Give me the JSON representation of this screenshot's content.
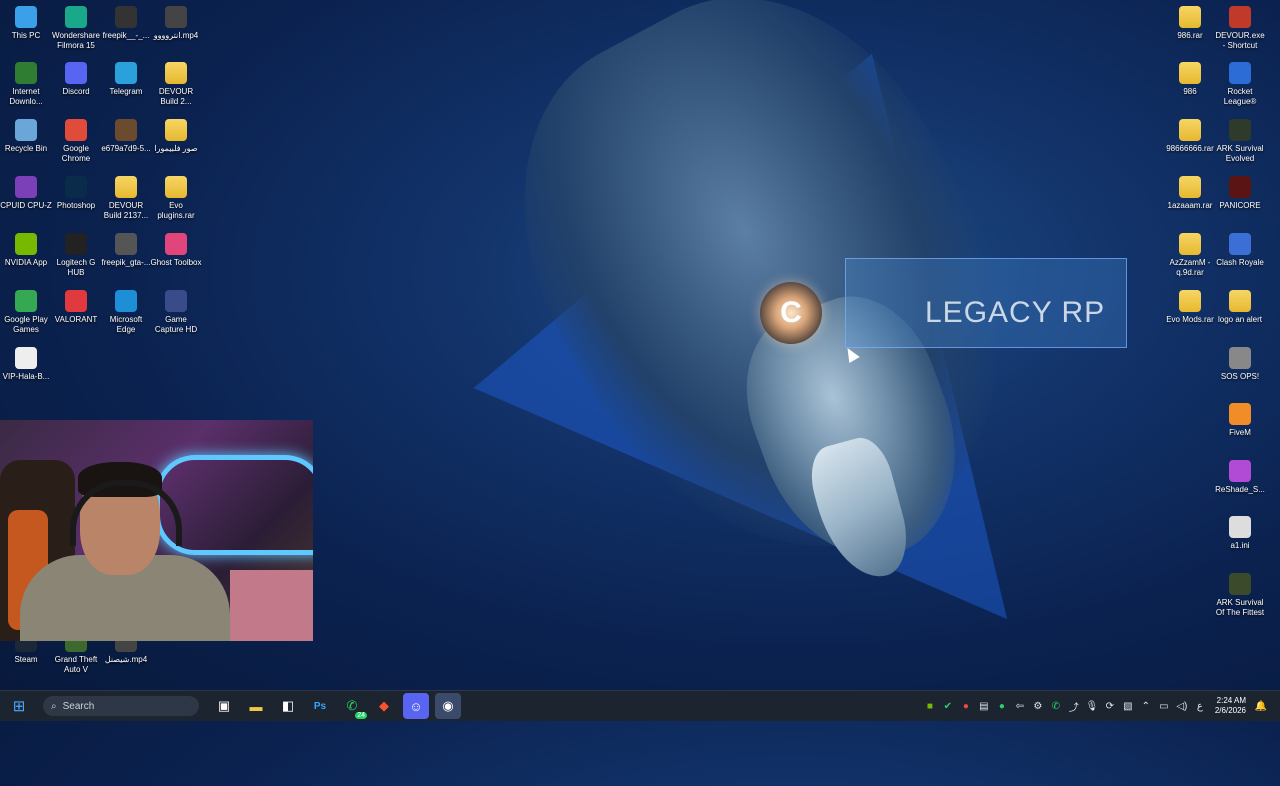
{
  "wallpaper": {
    "title_text": "LEGACY RP"
  },
  "desktop_icons_left": [
    {
      "label": "This PC",
      "icon": "monitor-icon",
      "color": "#3aa0e8"
    },
    {
      "label": "Wondershare Filmora 15",
      "icon": "filmora-icon",
      "color": "#1aa88a"
    },
    {
      "label": "freepik__-_...",
      "icon": "file-icon",
      "color": "#333"
    },
    {
      "label": "انتروووو.mp4",
      "icon": "video-file-icon",
      "color": "#444"
    },
    {
      "label": "Internet Downlo...",
      "icon": "idm-icon",
      "color": "#2e7d32"
    },
    {
      "label": "Discord",
      "icon": "discord-icon",
      "color": "#5865f2"
    },
    {
      "label": "Telegram",
      "icon": "telegram-icon",
      "color": "#2aa1da"
    },
    {
      "label": "DEVOUR Build 2...",
      "icon": "folder-icon",
      "color": "#e6b830"
    },
    {
      "label": "Recycle Bin",
      "icon": "recycle-bin-icon",
      "color": "#6aa7d8"
    },
    {
      "label": "Google Chrome",
      "icon": "chrome-icon",
      "color": "#e04b3a"
    },
    {
      "label": "e679a7d9-5...",
      "icon": "image-file-icon",
      "color": "#6b4a2e"
    },
    {
      "label": "صور فلبيمورا",
      "icon": "folder-icon",
      "color": "#e6b830"
    },
    {
      "label": "CPUID CPU-Z",
      "icon": "cpuz-icon",
      "color": "#7b3fb8"
    },
    {
      "label": "Photoshop",
      "icon": "photoshop-icon",
      "color": "#0b2b4a"
    },
    {
      "label": "DEVOUR Build 2137...",
      "icon": "folder-icon",
      "color": "#e6b830"
    },
    {
      "label": "Evo plugins.rar",
      "icon": "folder-icon",
      "color": "#e6b830"
    },
    {
      "label": "NVIDIA App",
      "icon": "nvidia-icon",
      "color": "#76b900"
    },
    {
      "label": "Logitech G HUB",
      "icon": "logitech-icon",
      "color": "#222"
    },
    {
      "label": "freepik_gta-...",
      "icon": "image-file-icon",
      "color": "#555"
    },
    {
      "label": "Ghost Toolbox",
      "icon": "ghost-icon",
      "color": "#e0457b"
    },
    {
      "label": "Google Play Games",
      "icon": "play-games-icon",
      "color": "#34a853"
    },
    {
      "label": "VALORANT",
      "icon": "valorant-icon",
      "color": "#e03a3e"
    },
    {
      "label": "Microsoft Edge",
      "icon": "edge-icon",
      "color": "#1c8fd6"
    },
    {
      "label": "Game Capture HD",
      "icon": "capture-icon",
      "color": "#3a4b8a"
    },
    {
      "label": "VIP-Hala-B...",
      "icon": "text-file-icon",
      "color": "#eeeeee"
    },
    {
      "label": "Steam",
      "icon": "steam-icon",
      "color": "#1b2838"
    },
    {
      "label": "Grand Theft Auto V",
      "icon": "gta-icon",
      "color": "#3b6a2c"
    },
    {
      "label": "شيصنل.mp4",
      "icon": "video-file-icon",
      "color": "#444"
    }
  ],
  "desktop_icons_right": [
    {
      "label": "986.rar",
      "icon": "folder-icon",
      "color": "#e6b830"
    },
    {
      "label": "DEVOUR.exe - Shortcut",
      "icon": "devour-icon",
      "color": "#c0392b"
    },
    {
      "label": "986",
      "icon": "folder-icon",
      "color": "#e6b830"
    },
    {
      "label": "Rocket League®",
      "icon": "rocket-league-icon",
      "color": "#2b6cd6"
    },
    {
      "label": "98666666.rar",
      "icon": "folder-icon",
      "color": "#e6b830"
    },
    {
      "label": "ARK Survival Evolved",
      "icon": "ark-icon",
      "color": "#2f3b2a"
    },
    {
      "label": "1azaaam.rar",
      "icon": "folder-icon",
      "color": "#e6b830"
    },
    {
      "label": "PANICORE",
      "icon": "panicore-icon",
      "color": "#5a1414"
    },
    {
      "label": "AzZzamM - q.9d.rar",
      "icon": "folder-icon",
      "color": "#e6b830"
    },
    {
      "label": "Clash Royale",
      "icon": "clash-royale-icon",
      "color": "#3c6fd6"
    },
    {
      "label": "Evo Mods.rar",
      "icon": "folder-icon",
      "color": "#e6b830"
    },
    {
      "label": "logo an alert",
      "icon": "folder-icon",
      "color": "#e6b830"
    },
    {
      "label": "SOS OPS!",
      "icon": "sos-ops-icon",
      "color": "#888"
    },
    {
      "label": "FiveM",
      "icon": "fivem-icon",
      "color": "#f28c28"
    },
    {
      "label": "ReShade_S...",
      "icon": "reshade-icon",
      "color": "#b14bd6"
    },
    {
      "label": "a1.ini",
      "icon": "ini-file-icon",
      "color": "#ddd"
    },
    {
      "label": "ARK Survival Of The Fittest",
      "icon": "ark-sotf-icon",
      "color": "#3a4a2a"
    }
  ],
  "taskbar": {
    "search_label": "Search",
    "pinned": [
      {
        "name": "task-view-icon",
        "glyph": "▣"
      },
      {
        "name": "file-explorer-icon",
        "glyph": "▬"
      },
      {
        "name": "app-icon",
        "glyph": "◧"
      },
      {
        "name": "photoshop-taskbar-icon",
        "glyph": "Ps"
      },
      {
        "name": "whatsapp-icon",
        "glyph": "✆"
      },
      {
        "name": "brave-icon",
        "glyph": "◆"
      },
      {
        "name": "discord-taskbar-icon",
        "glyph": "☺"
      },
      {
        "name": "obs-icon",
        "glyph": "◉"
      }
    ],
    "whatsapp_badge": "24",
    "clock_time": "2:24 AM",
    "clock_date": "2/6/2026"
  }
}
